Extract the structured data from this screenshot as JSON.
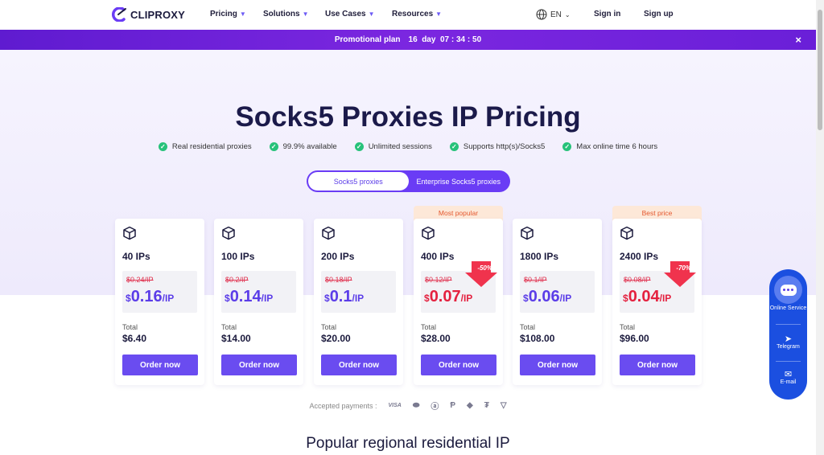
{
  "brand": {
    "name": "CLIPROXY",
    "accent": "#6a4cf0",
    "promo_color": "#6a1fd8"
  },
  "nav": {
    "items": [
      {
        "label": "Pricing"
      },
      {
        "label": "Solutions"
      },
      {
        "label": "Use Cases"
      },
      {
        "label": "Resources"
      }
    ],
    "language": "EN",
    "signin": "Sign in",
    "signup": "Sign up"
  },
  "promo": {
    "label": "Promotional plan",
    "countdown": "16  day  07 : 34 : 50",
    "close": "×"
  },
  "hero": {
    "title": "Socks5 Proxies IP Pricing",
    "features": [
      "Real residential proxies",
      "99.9% available",
      "Unlimited sessions",
      "Supports http(s)/Socks5",
      "Max online time 6 hours"
    ],
    "tabs": [
      {
        "label": "Socks5 proxies",
        "active": true
      },
      {
        "label": "Enterprise Socks5 proxies",
        "active": false
      }
    ]
  },
  "plans": [
    {
      "ips": "40 IPs",
      "old": "$0.24/IP",
      "price": "0.16",
      "unit": "/IP",
      "total_label": "Total",
      "total": "$6.40",
      "order": "Order now"
    },
    {
      "ips": "100 IPs",
      "old": "$0.2/IP",
      "price": "0.14",
      "unit": "/IP",
      "total_label": "Total",
      "total": "$14.00",
      "order": "Order now"
    },
    {
      "ips": "200 IPs",
      "old": "$0.18/IP",
      "price": "0.1",
      "unit": "/IP",
      "total_label": "Total",
      "total": "$20.00",
      "order": "Order now"
    },
    {
      "ips": "400 IPs",
      "old": "$0.12/IP",
      "price": "0.07",
      "unit": "/IP",
      "total_label": "Total",
      "total": "$28.00",
      "order": "Order now",
      "badge": "Most popular",
      "discount": "-50%"
    },
    {
      "ips": "1800 IPs",
      "old": "$0.1/IP",
      "price": "0.06",
      "unit": "/IP",
      "total_label": "Total",
      "total": "$108.00",
      "order": "Order now"
    },
    {
      "ips": "2400 IPs",
      "old": "$0.08/IP",
      "price": "0.04",
      "unit": "/IP",
      "total_label": "Total",
      "total": "$96.00",
      "order": "Order now",
      "badge": "Best price",
      "discount": "-70%"
    }
  ],
  "currency": "$",
  "payments": {
    "label": "Accepted payments :",
    "methods": [
      "VISA",
      "mastercard",
      "alipay",
      "paypal",
      "ethereum",
      "tether",
      "tron"
    ]
  },
  "regional": {
    "title": "Popular regional residential IP"
  },
  "float": {
    "online": "Online Service",
    "telegram": "Telegram",
    "email": "E-mail"
  }
}
